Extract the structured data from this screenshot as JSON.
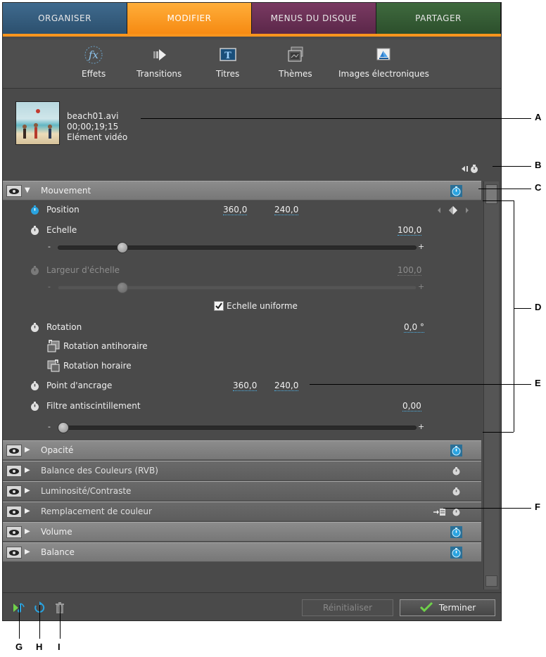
{
  "tabs": [
    {
      "label": "ORGANISER",
      "active": false
    },
    {
      "label": "MODIFIER",
      "active": true
    },
    {
      "label": "MENUS DU DISQUE",
      "active": false
    },
    {
      "label": "PARTAGER",
      "active": false
    }
  ],
  "toolbar": {
    "effects": "Effets",
    "transitions": "Transitions",
    "titles": "Titres",
    "themes": "Thèmes",
    "electronic_images": "Images électroniques"
  },
  "clip": {
    "filename": "beach01.avi",
    "timecode": "00;00;19;15",
    "type": "Elément vidéo"
  },
  "motion": {
    "header": "Mouvement",
    "position_label": "Position",
    "position_x": "360,0",
    "position_y": "240,0",
    "scale_label": "Echelle",
    "scale_value": "100,0",
    "scale_slider_fraction": 0.17,
    "scale_width_label": "Largeur d'échelle",
    "scale_width_value": "100,0",
    "scale_width_slider_fraction": 0.17,
    "uniform_scale_label": "Echelle uniforme",
    "uniform_scale_checked": true,
    "rotation_label": "Rotation",
    "rotation_value": "0,0 °",
    "rotate_ccw_label": "Rotation antihoraire",
    "rotate_cw_label": "Rotation horaire",
    "anchor_label": "Point d'ancrage",
    "anchor_x": "360,0",
    "anchor_y": "240,0",
    "flicker_label": "Filtre antiscintillement",
    "flicker_value": "0,00",
    "flicker_slider_fraction": 0.0,
    "slider_min": "-",
    "slider_max": "+"
  },
  "effects": [
    {
      "name": "Opacité",
      "dim": false
    },
    {
      "name": "Balance des Couleurs (RVB)",
      "dim": true
    },
    {
      "name": "Luminosité/Contraste",
      "dim": true
    },
    {
      "name": "Remplacement de couleur",
      "dim": true
    },
    {
      "name": "Volume",
      "dim": false
    },
    {
      "name": "Balance",
      "dim": false
    }
  ],
  "footer": {
    "reset_label": "Réinitialiser",
    "done_label": "Terminer"
  },
  "callouts": {
    "a": "A",
    "b": "B",
    "c": "C",
    "d": "D",
    "e": "E",
    "f": "F",
    "g": "G",
    "h": "H",
    "i": "I"
  },
  "colors": {
    "accent_orange": "#f7941d",
    "stopwatch_blue": "#29a3e0",
    "done_check_green": "#6fd14a"
  }
}
